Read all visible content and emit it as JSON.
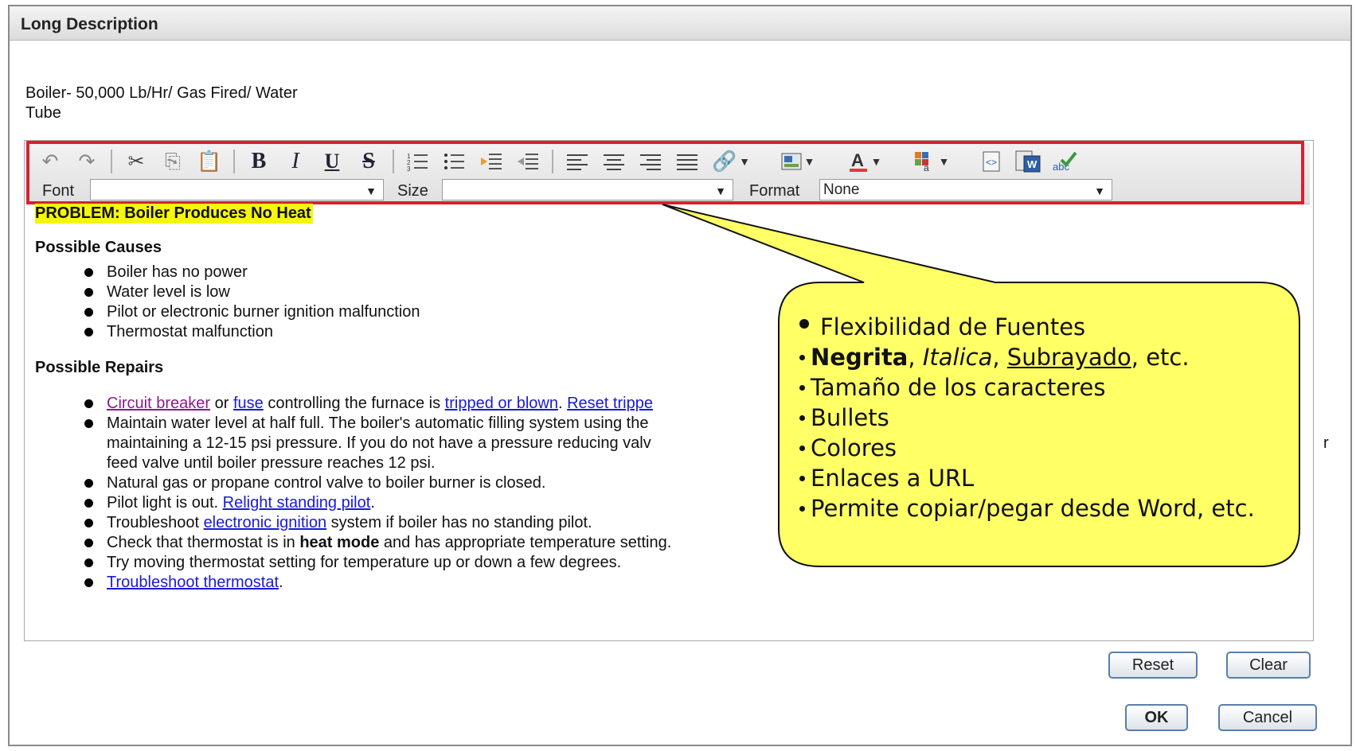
{
  "dialog": {
    "title": "Long Description",
    "description": "Boiler- 50,000 Lb/Hr/ Gas Fired/ Water Tube",
    "description_line1": "Boiler- 50,000 Lb/Hr/ Gas Fired/ Water",
    "description_line2": "Tube"
  },
  "toolbar": {
    "icons": [
      "undo-icon",
      "redo-icon",
      "cut-icon",
      "copy-icon",
      "paste-icon",
      "bold-icon",
      "italic-icon",
      "underline-icon",
      "strikethrough-icon",
      "ordered-list-icon",
      "unordered-list-icon",
      "indent-icon",
      "outdent-icon",
      "align-left-icon",
      "align-center-icon",
      "align-right-icon",
      "justify-icon",
      "link-icon",
      "image-icon",
      "font-color-icon",
      "background-color-icon",
      "source-icon",
      "paste-from-word-icon",
      "spellcheck-icon"
    ],
    "bold": "B",
    "italic": "I",
    "underline": "U",
    "strike": "S",
    "font_label": "Font",
    "font_value": "",
    "size_label": "Size",
    "size_value": "",
    "format_label": "Format",
    "format_value": "None",
    "font_color_glyph": "A"
  },
  "content": {
    "problem": "PROBLEM: Boiler Produces No Heat",
    "causes_heading": "Possible Causes",
    "causes": [
      "Boiler has no power",
      "Water level is low",
      "Pilot or electronic burner ignition malfunction",
      "Thermostat malfunction"
    ],
    "repairs_heading": "Possible Repairs",
    "repair1": {
      "link1": "Circuit breaker",
      "t1": " or ",
      "link2": "fuse",
      "t2": " controlling the furnace is ",
      "link3": "tripped or blown",
      "t3": ". ",
      "link4": "Reset trippe"
    },
    "repair2": {
      "line1": "Maintain water level at half full. The boiler's automatic filling system using the",
      "line2": "maintaining a 12-15 psi pressure. If you do not have a pressure reducing valv",
      "line2_tail": "r",
      "line3": "feed valve until boiler pressure reaches 12 psi."
    },
    "repair3": "Natural gas or propane control valve to boiler burner is closed.",
    "repair4": {
      "t1": "Pilot light is out. ",
      "link": "Relight standing pilot",
      "t2": "."
    },
    "repair5": {
      "t1": "Troubleshoot ",
      "link": "electronic ignition",
      "t2": " system if boiler has no standing pilot."
    },
    "repair6": {
      "t1": "Check that thermostat is in ",
      "bold": "heat mode",
      "t2": " and has appropriate temperature setting."
    },
    "repair7": "Try moving thermostat setting for temperature up or down a few degrees.",
    "repair8": {
      "link": "Troubleshoot thermostat",
      "t2": "."
    }
  },
  "buttons": {
    "reset": "Reset",
    "clear": "Clear",
    "ok": "OK",
    "cancel": "Cancel"
  },
  "callout": {
    "item1": "Flexibilidad de Fuentes",
    "item2_bold": "Negrita",
    "item2_sep1": ", ",
    "item2_italic": "Italica",
    "item2_sep2": ", ",
    "item2_underline": "Subrayado",
    "item2_tail": ", etc.",
    "item3": "Tamaño de los caracteres",
    "item4": "Bullets",
    "item5": "Colores",
    "item6": "Enlaces a URL",
    "item7": "Permite copiar/pegar desde Word, etc.",
    "fill_color": "#ffff66",
    "highlight_color": "#d9202f"
  }
}
